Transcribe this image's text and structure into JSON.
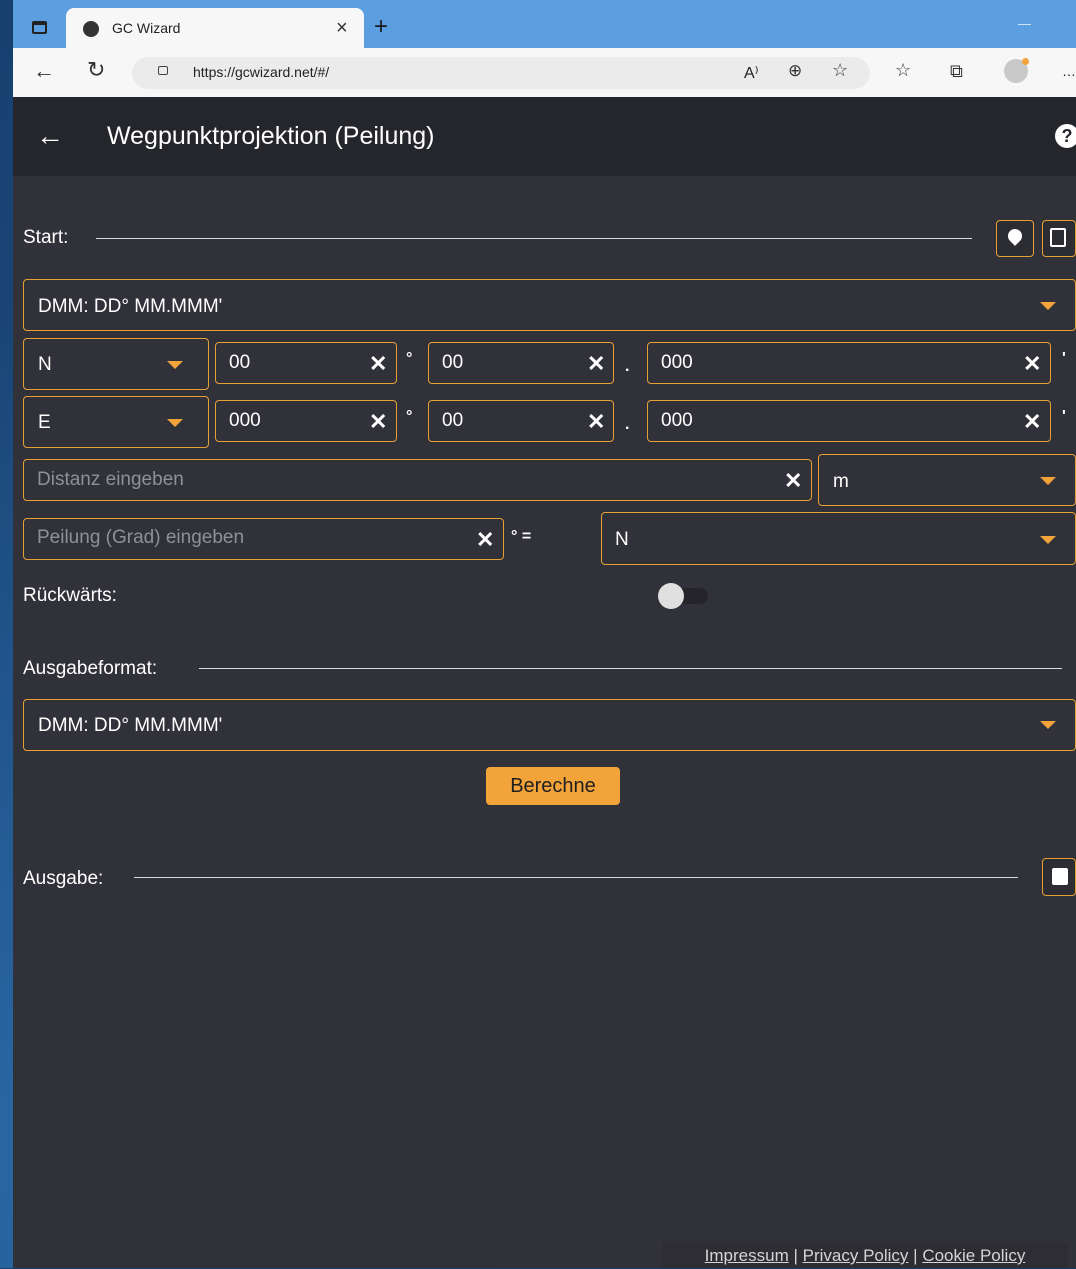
{
  "browser": {
    "tab_title": "GC Wizard",
    "tab_close": "×",
    "new_tab": "+",
    "url": "https://gcwizard.net/#/",
    "read_aloud": "A⁾",
    "more": "…"
  },
  "appbar": {
    "title": "Wegpunktprojektion (Peilung)",
    "help": "?"
  },
  "start": {
    "label": "Start:",
    "format_selected": "DMM: DD° MM.MMM'",
    "lat": {
      "hemisphere": "N",
      "degrees": "00",
      "minutes": "00",
      "decimals": "000"
    },
    "lon": {
      "hemisphere": "E",
      "degrees": "000",
      "minutes": "00",
      "decimals": "000"
    }
  },
  "distance": {
    "placeholder": "Distanz eingeben",
    "unit": "m"
  },
  "bearing": {
    "placeholder": "Peilung (Grad) eingeben",
    "suffix": "° =",
    "direction": "N"
  },
  "reverse": {
    "label": "Rückwärts:",
    "checked": false
  },
  "output_format": {
    "label": "Ausgabeformat:",
    "selected": "DMM: DD° MM.MMM'"
  },
  "calculate_label": "Berechne",
  "output": {
    "label": "Ausgabe:"
  },
  "symbols": {
    "degree": "°",
    "dot": ".",
    "minute": "'",
    "clear": "✕"
  },
  "footer": {
    "impressum": "Impressum",
    "privacy": "Privacy Policy",
    "cookie": "Cookie Policy",
    "separator": "|"
  },
  "colors": {
    "accent": "#f2a33a",
    "background": "#313139",
    "appbar": "#24262b"
  }
}
